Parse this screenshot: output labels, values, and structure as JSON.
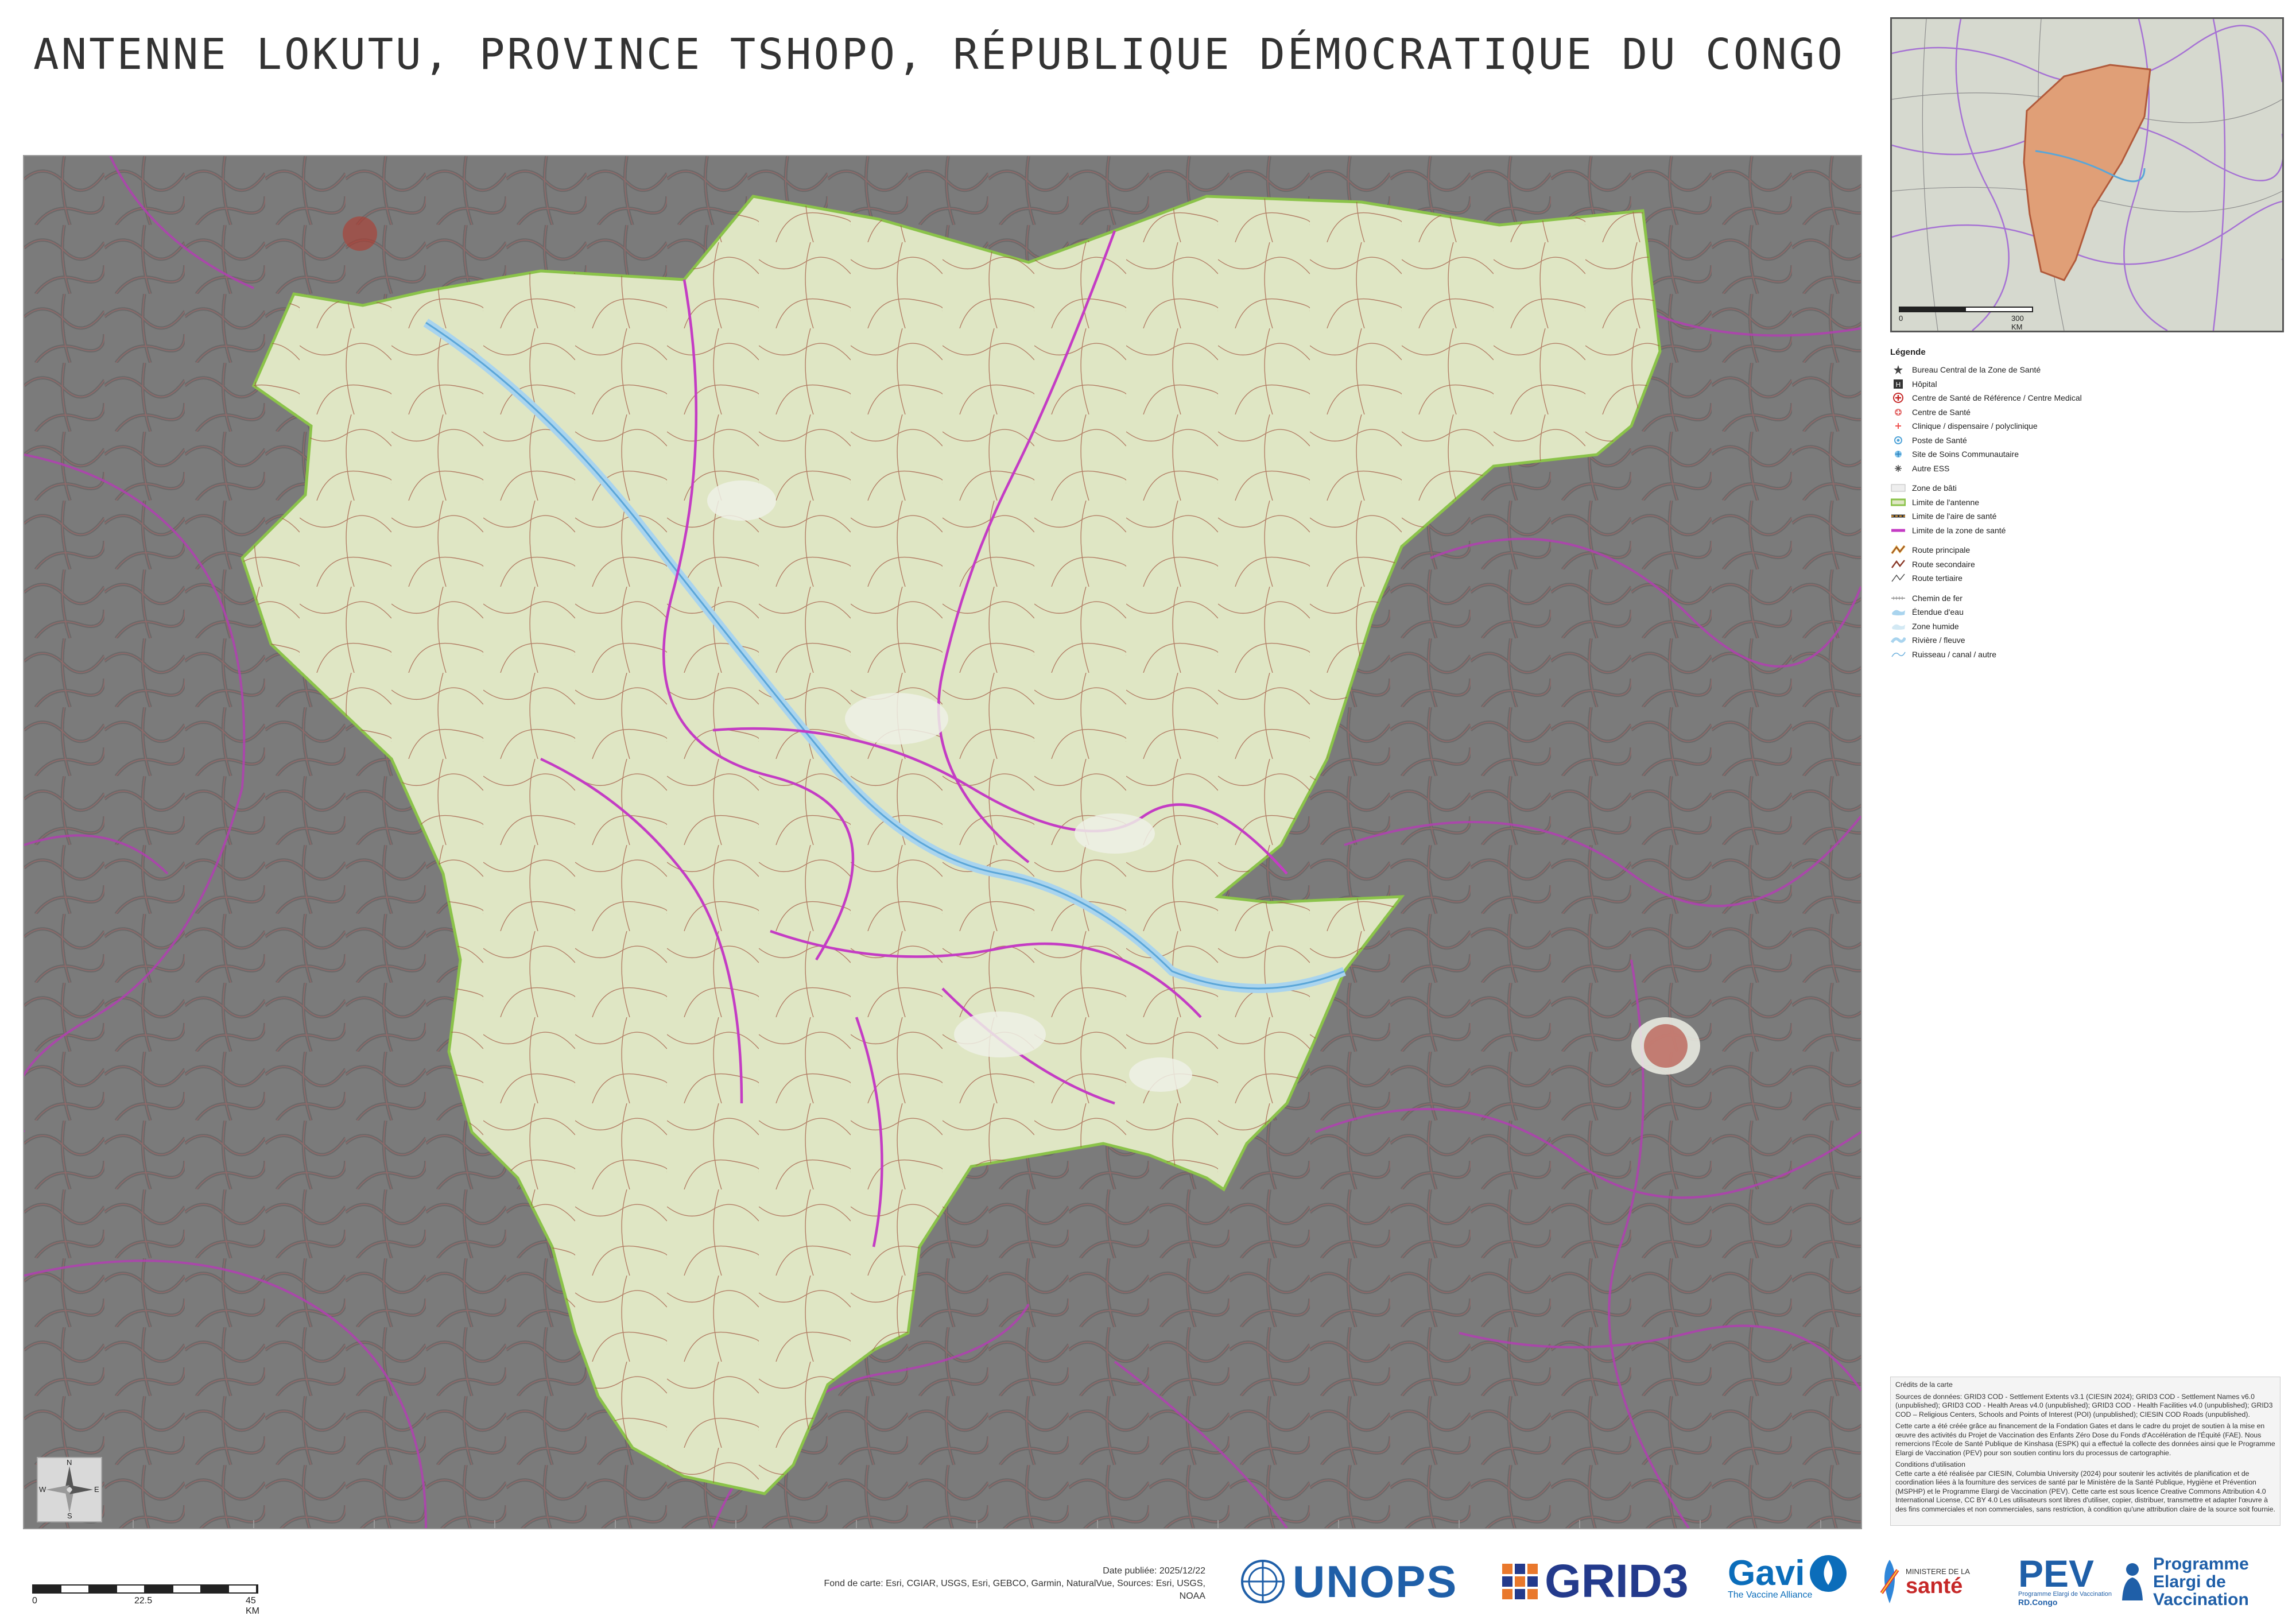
{
  "title": "ANTENNE LOKUTU, PROVINCE TSHOPO, RÉPUBLIQUE DÉMOCRATIQUE DU CONGO",
  "inset": {
    "scale_start": "0",
    "scale_end": "300 KM"
  },
  "legend": {
    "heading": "Légende",
    "items": [
      {
        "label": "Bureau Central de la Zone de Santé",
        "icon": "bcz-icon"
      },
      {
        "label": "Hôpital",
        "icon": "hospital-icon"
      },
      {
        "label": "Centre de Santé de Référence / Centre Medical",
        "icon": "csr-icon"
      },
      {
        "label": "Centre de Santé",
        "icon": "health-center-icon"
      },
      {
        "label": "Clinique / dispensaire / polyclinique",
        "icon": "clinic-icon"
      },
      {
        "label": "Poste de Santé",
        "icon": "health-post-icon"
      },
      {
        "label": "Site de Soins Communautaire",
        "icon": "community-site-icon"
      },
      {
        "label": "Autre ESS",
        "icon": "other-ess-icon"
      },
      {
        "label": "Zone de bâti",
        "icon": "builtup-icon"
      },
      {
        "label": "Limite de l'antenne",
        "icon": "antenna-boundary-icon"
      },
      {
        "label": "Limite de l'aire de santé",
        "icon": "health-area-boundary-icon"
      },
      {
        "label": "Limite de la zone de santé",
        "icon": "health-zone-boundary-icon"
      },
      {
        "label": "Route principale",
        "icon": "primary-road-icon"
      },
      {
        "label": "Route secondaire",
        "icon": "secondary-road-icon"
      },
      {
        "label": "Route tertiaire",
        "icon": "tertiary-road-icon"
      },
      {
        "label": "Chemin de fer",
        "icon": "railway-icon"
      },
      {
        "label": "Étendue d'eau",
        "icon": "water-body-icon"
      },
      {
        "label": "Zone humide",
        "icon": "wetland-icon"
      },
      {
        "label": "Rivière / fleuve",
        "icon": "river-icon"
      },
      {
        "label": "Ruisseau / canal / autre",
        "icon": "stream-icon"
      }
    ]
  },
  "credits": {
    "heading": "Crédits de la carte",
    "sources": "Sources de données: GRID3 COD - Settlement Extents v3.1 (CIESIN 2024); GRID3 COD - Settlement Names v6.0 (unpublished); GRID3 COD - Health Areas v4.0 (unpublished); GRID3 COD - Health Facilities v4.0 (unpublished); GRID3 COD – Religious Centers, Schools and Points of Interest (POI) (unpublished); CIESIN COD Roads (unpublished).",
    "funding": "Cette carte a été créée grâce au financement de la Fondation Gates et dans le cadre du projet de soutien à la mise en œuvre des activités du Projet de Vaccination des Enfants Zéro Dose du Fonds d'Accélération de l'Équité (FAE). Nous remercions l'École de Santé Publique de Kinshasa (ESPK) qui a effectué la collecte des données ainsi que le Programme Elargi de Vaccination (PEV) pour son soutien continu lors du processus de cartographie.",
    "conditions_heading": "Conditions d'utilisation",
    "conditions": "Cette carte a été réalisée par CIESIN, Columbia University (2024) pour soutenir les activités de planification et de coordination liées à la fourniture des services de santé par le Ministère de la Santé Publique, Hygiène et Prévention (MSPHP) et le Programme Elargi de Vaccination (PEV). Cette carte est sous licence Creative Commons Attribution 4.0 International License, CC BY 4.0 Les utilisateurs sont libres d'utiliser, copier, distribuer, transmettre et adapter l'œuvre à des fins commerciales et non commerciales, sans restriction, à condition qu'une attribution claire de la source soit fournie."
  },
  "north_arrow": {
    "n": "N",
    "s": "S",
    "e": "E",
    "w": "W"
  },
  "scale": {
    "ticks": [
      "0",
      "22.5",
      "45 KM"
    ]
  },
  "date_published": "Date publiée: 2025/12/22",
  "basemap_credit": "Fond de carte: Esri, CGIAR, USGS, Esri, GEBCO, Garmin, NaturalVue, Sources: Esri, USGS, NOAA",
  "logos": {
    "unops": "UNOPS",
    "grid3": "GRID3",
    "gavi": "Gavi",
    "gavi_tagline": "The Vaccine Alliance",
    "ministry_line1": "MINISTERE DE LA",
    "ministry_line2": "santé",
    "pev": "PEV",
    "pev_sub": "Programme Elargi de Vaccination",
    "pev_country": "RD.Congo",
    "pev_full_1": "Programme",
    "pev_full_2": "Elargi de",
    "pev_full_3": "Vaccination"
  },
  "colors": {
    "antenna_fill": "#dfe6c4",
    "outside_fill": "#7b7b7b",
    "antenna_boundary": "#8bc34a",
    "health_zone_boundary": "#c43cc4",
    "roads": "#8b3a2a",
    "water": "#a9d4ee"
  }
}
